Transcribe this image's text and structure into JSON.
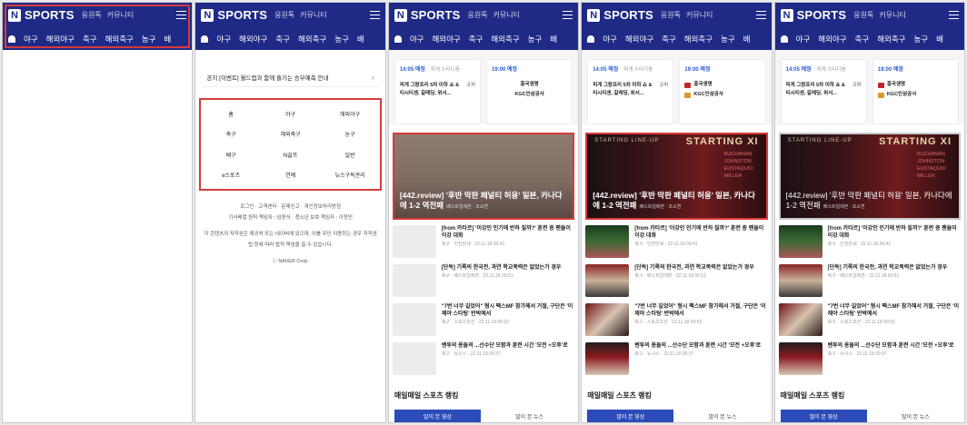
{
  "header": {
    "logo_letter": "N",
    "logo_text": "SPORTS",
    "nav": [
      "응원톡",
      "커뮤니티"
    ],
    "categories": [
      "야구",
      "해외야구",
      "축구",
      "해외축구",
      "농구",
      "배"
    ]
  },
  "menu_page": {
    "notice": "공지 [이벤트] 월드컵과 함께 즐기는 승부예측 안내",
    "category_grid": [
      "홈",
      "야구",
      "해외야구",
      "축구",
      "해외축구",
      "농구",
      "배구",
      "N골프",
      "일반",
      "e스포츠",
      "연예",
      "뉴스구독관리"
    ],
    "links": [
      "로그인 · 고객센터 · 문제신고 · 개인정보처리방침",
      "기사배열 원칙 책임자 : 임동식 · 청소년 보호 책임자 : 이정민",
      "각 콘텐츠의 저작권은 제공처 또는 네이버에 있으며, 이를 무단 이용하는 경우 저작권법 등에 따라 법적 책임을 질 수 있습니다.",
      "ⓒ NAVER Corp."
    ]
  },
  "schedule": {
    "card1": {
      "time": "14:05 예정",
      "stadium": "피게 스타디움",
      "title": "피게 그랑프리 5차 이하 쇼 & 티시티센, 갈레딩, 위서...",
      "badge": "코퍼"
    },
    "card2": {
      "time": "19:00 예정",
      "team_home": "흥국생명",
      "team_away": "KGC인삼공사"
    }
  },
  "hero": {
    "caption": "[442.review] '후반 막판 페널티 허용' 일본, 카나다에 1-2 역전패",
    "source": "베스트일레븐 · 조소연",
    "lineup_label": "STARTING LINE-UP",
    "starting_xi": "STARTING XI",
    "player_names": [
      "BUCHANAN",
      "JOHNSTON",
      "EUSTAQUIO",
      "MILLER"
    ]
  },
  "news": [
    {
      "title": "[from 카타르] '이강인 인기에 반하 질까?' 훈련 중 팬들이 이강 대화",
      "meta": "축구 · 인천만세 · 22.11.18 00:41"
    },
    {
      "title": "[단독] 기록의 한국전, 과연 학교폭력은 없었는가 경우",
      "meta": "축구 · 베스트일레븐 · 22.11.18 00:51"
    },
    {
      "title": "\"7번 너무 길었어\" 형시 팩스MF 참가해서 거절, 구단은 '이제야 스타팅' 반박에서",
      "meta": "축구 · 스포츠조선 · 22.11.18 00:52"
    },
    {
      "title": "벤투의 용들의 ...선수단 모함과 훈련 시간 '모전 +오후'로",
      "meta": "축구 · 뉴시스 · 22.11.18 00:37"
    }
  ],
  "ranking": {
    "title": "매일매일 스포츠 랭킹",
    "tabs": [
      "많이 본 영상",
      "많이 본 뉴스"
    ]
  },
  "colors": {
    "header_bg": "#1e2a86",
    "highlight": "#d93a3a",
    "accent_blue": "#2a5bd7",
    "tab_active": "#2b4cb8"
  }
}
